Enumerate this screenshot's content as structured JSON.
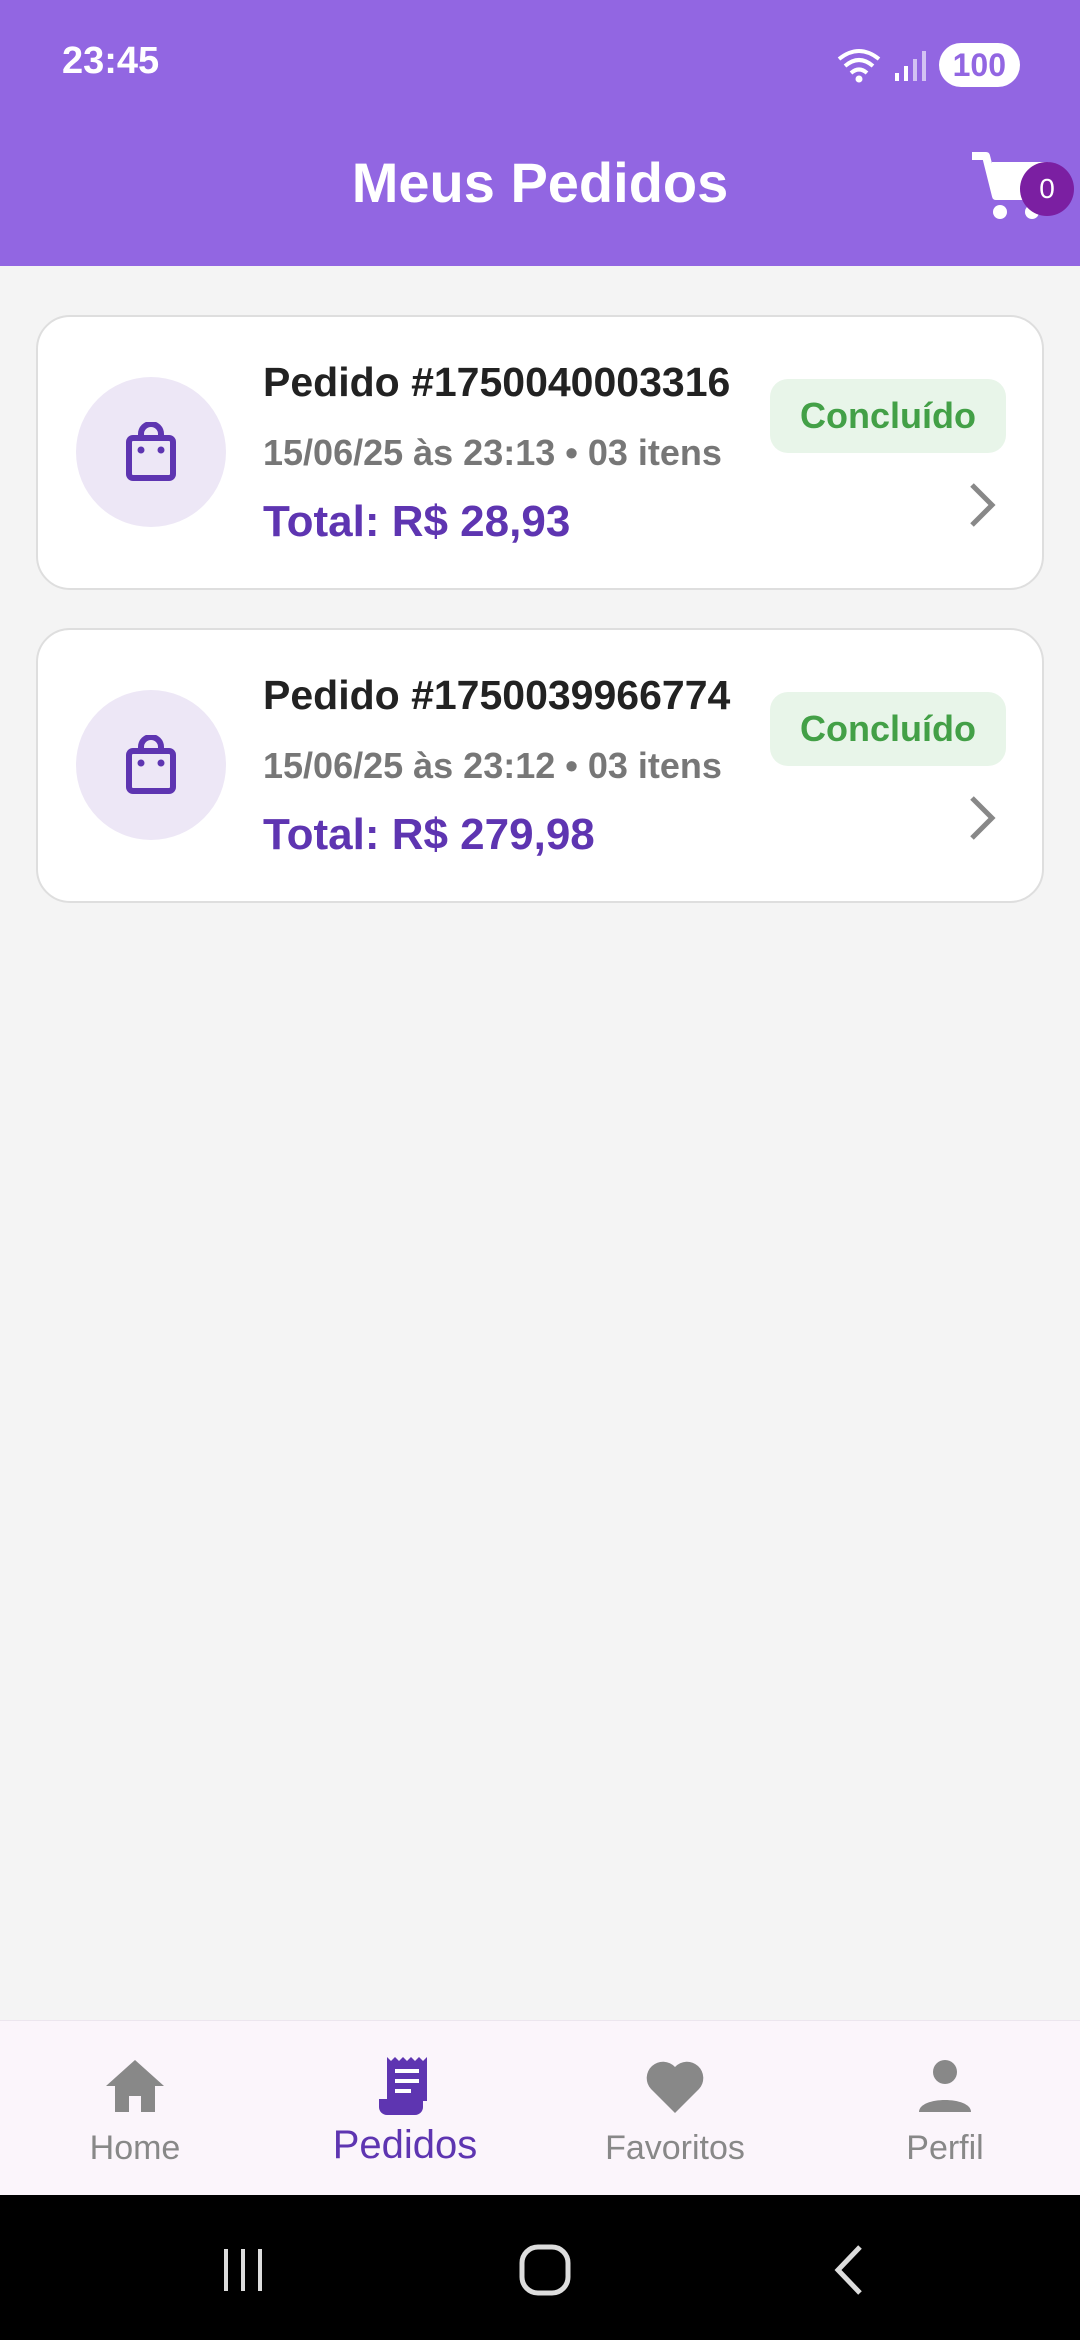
{
  "status_bar": {
    "time": "23:45",
    "battery": "100"
  },
  "header": {
    "title": "Meus Pedidos",
    "cart_count": "0"
  },
  "orders": [
    {
      "title": "Pedido #1750040003316",
      "meta": "15/06/25 às 23:13 • 03 itens",
      "total": "Total: R$ 28,93",
      "status": "Concluído"
    },
    {
      "title": "Pedido #1750039966774",
      "meta": "15/06/25 às 23:12 • 03 itens",
      "total": "Total: R$ 279,98",
      "status": "Concluído"
    }
  ],
  "bottom_nav": [
    {
      "label": "Home",
      "icon": "home-icon",
      "active": false
    },
    {
      "label": "Pedidos",
      "icon": "receipt-icon",
      "active": true
    },
    {
      "label": "Favoritos",
      "icon": "heart-icon",
      "active": false
    },
    {
      "label": "Perfil",
      "icon": "person-icon",
      "active": false
    }
  ],
  "colors": {
    "primary": "#9266e2",
    "accent": "#5e35b1",
    "success": "#43a047",
    "badge": "#7b1fa2"
  }
}
